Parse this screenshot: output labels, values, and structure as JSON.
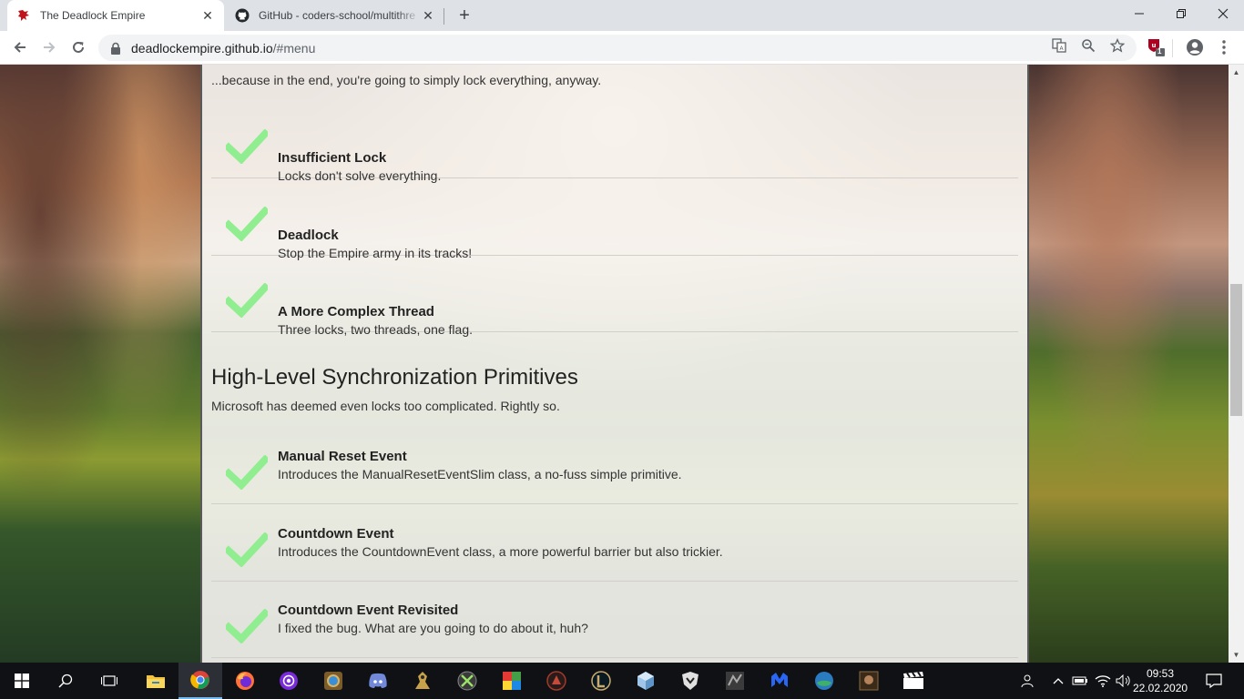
{
  "browser": {
    "tabs": [
      {
        "title": "The Deadlock Empire",
        "active": true
      },
      {
        "title": "GitHub - coders-school/multithre",
        "active": false
      }
    ],
    "url_host": "deadlockempire.github.io",
    "url_path": "/#menu",
    "extension_badge": "1"
  },
  "page": {
    "intro_text": "...because in the end, you're going to simply lock everything, anyway.",
    "levels_top": [
      {
        "name": "Insufficient Lock",
        "description": "Locks don't solve everything."
      },
      {
        "name": "Deadlock",
        "description": "Stop the Empire army in its tracks!"
      },
      {
        "name": "A More Complex Thread",
        "description": "Three locks, two threads, one flag."
      }
    ],
    "section": {
      "title": "High-Level Synchronization Primitives",
      "description": "Microsoft has deemed even locks too complicated. Rightly so."
    },
    "levels_bottom": [
      {
        "name": "Manual Reset Event",
        "description": "Introduces the ManualResetEventSlim class, a no-fuss simple primitive."
      },
      {
        "name": "Countdown Event",
        "description": "Introduces the CountdownEvent class, a more powerful barrier but also trickier."
      },
      {
        "name": "Countdown Event Revisited",
        "description": "I fixed the bug. What are you going to do about it, huh?"
      }
    ],
    "check_color": "#90ee90"
  },
  "taskbar": {
    "time": "09:53",
    "date": "22.02.2020"
  }
}
